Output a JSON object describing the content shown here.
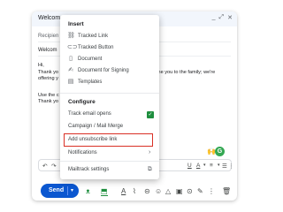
{
  "compose": {
    "title": "Welcom",
    "window_controls": [
      "_",
      "⤢",
      "✕"
    ],
    "to_placeholder": "Recipien",
    "subject": "Welcom",
    "body_lines": [
      "Hi,",
      "Thank yo",
      "offering y",
      "Use the c",
      "Thank yo"
    ],
    "body_right_line": "come you to the family; we're"
  },
  "format_bar": {
    "undo": "↶",
    "underline": "U",
    "text_color": "A",
    "align": "≡",
    "list": "☰",
    "more": "⋮"
  },
  "bottom_bar": {
    "send_label": "Send",
    "send_caret": "▾",
    "icons": [
      "mailtrack-icon",
      "tracked-link-icon",
      "text-format-icon",
      "attach-icon",
      "link-icon",
      "emoji-icon",
      "drive-icon",
      "photo-icon",
      "lock-icon",
      "pen-icon",
      "more-icon",
      "trash-icon"
    ]
  },
  "dropdown": {
    "insert_header": "Insert",
    "insert_items": [
      {
        "label": "Tracked Link",
        "icon": "link-icon"
      },
      {
        "label": "Tracked Button",
        "icon": "button-icon"
      },
      {
        "label": "Document",
        "icon": "document-icon"
      },
      {
        "label": "Document for Signing",
        "icon": "signature-icon"
      },
      {
        "label": "Templates",
        "icon": "template-icon"
      }
    ],
    "configure_header": "Configure",
    "track_opens": "Track email opens",
    "track_opens_checked": true,
    "campaign": "Campaign / Mail Merge",
    "unsubscribe": "Add unsubscribe link",
    "notifications": "Notifications",
    "settings": "Mailtrack settings"
  },
  "colors": {
    "accent": "#0b57d0",
    "mailtrack_green": "#1e8e3e",
    "highlight_border": "#d93025"
  }
}
